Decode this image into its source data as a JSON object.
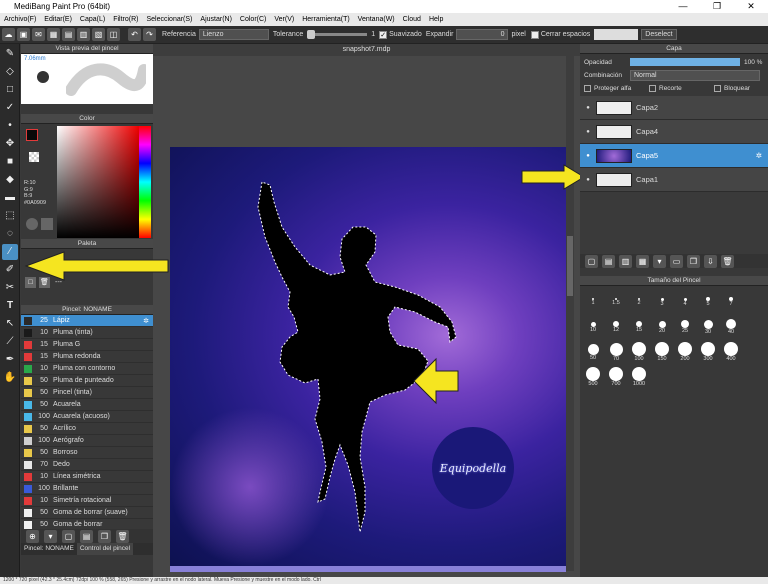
{
  "window": {
    "title": "MediBang Paint Pro (64bit)",
    "min": "—",
    "max": "❐",
    "close": "✕"
  },
  "menu": [
    "Archivo(F)",
    "Editar(E)",
    "Capa(L)",
    "Filtro(R)",
    "Seleccionar(S)",
    "Ajustar(N)",
    "Color(C)",
    "Ver(V)",
    "Herramienta(T)",
    "Ventana(W)",
    "Cloud",
    "Help"
  ],
  "toolbar": {
    "referencia_label": "Referencia",
    "referencia_value": "Lienzo",
    "tolerance_label": "Tolerance",
    "tolerance_value": "1",
    "suavizado_label": "Suavizado",
    "expandir_label": "Expandir",
    "expandir_value": "0",
    "expandir_unit": "pixel",
    "cerrar_label": "Cerrar espacios",
    "deselect_label": "Deselect"
  },
  "preview_panel": {
    "title": "Vista previa del pincel",
    "size": "7.06mm"
  },
  "color_panel": {
    "title": "Color",
    "r": "R:10",
    "g": "G:9",
    "b": "B:9",
    "hex": "#0A0909"
  },
  "palette_panel": {
    "title": "Paleta",
    "empty": "---"
  },
  "brush_panel": {
    "title": "Pincel: NONAME",
    "brushes": [
      {
        "size": "25",
        "name": "Lápiz",
        "color": "#2a2a2a",
        "selected": true
      },
      {
        "size": "10",
        "name": "Pluma (tinta)",
        "color": "#1a1a1a"
      },
      {
        "size": "15",
        "name": "Pluma G",
        "color": "#e23a3a"
      },
      {
        "size": "15",
        "name": "Pluma redonda",
        "color": "#e23a3a"
      },
      {
        "size": "10",
        "name": "Pluma con contorno",
        "color": "#2aa84a"
      },
      {
        "size": "50",
        "name": "Pluma de punteado",
        "color": "#e8c84a"
      },
      {
        "size": "50",
        "name": "Pincel (tinta)",
        "color": "#e8c84a"
      },
      {
        "size": "50",
        "name": "Acuarela",
        "color": "#49b8e8"
      },
      {
        "size": "100",
        "name": "Acuarela (acuoso)",
        "color": "#49b8e8"
      },
      {
        "size": "50",
        "name": "Acrílico",
        "color": "#e8c84a"
      },
      {
        "size": "100",
        "name": "Aerógrafo",
        "color": "#cfcfcf"
      },
      {
        "size": "50",
        "name": "Borroso",
        "color": "#e8c84a"
      },
      {
        "size": "70",
        "name": "Dedo",
        "color": "#e8e8e8"
      },
      {
        "size": "10",
        "name": "Línea simétrica",
        "color": "#e23a3a"
      },
      {
        "size": "100",
        "name": "Brillante",
        "color": "#3a5ad8"
      },
      {
        "size": "10",
        "name": "Simetría rotacional",
        "color": "#e23a3a"
      },
      {
        "size": "50",
        "name": "Goma de borrar (suave)",
        "color": "#f0f0f0"
      },
      {
        "size": "50",
        "name": "Goma de borrar",
        "color": "#f0f0f0"
      }
    ],
    "tab1": "Pincel: NONAME",
    "tab2": "Control del pincel"
  },
  "canvas": {
    "doc_tab": "snapshot7.mdp",
    "watermark": "Equipodella",
    "accent": "#f5e520"
  },
  "layer_panel": {
    "title": "Capa",
    "opacity_label": "Opacidad",
    "opacity_value": "100 %",
    "blend_label": "Combinación",
    "blend_value": "Normal",
    "protect_label": "Proteger alfa",
    "clip_label": "Recorte",
    "lock_label": "Bloquear",
    "layers": [
      {
        "name": "Capa2",
        "selected": false
      },
      {
        "name": "Capa4",
        "selected": false
      },
      {
        "name": "Capa5",
        "selected": true
      },
      {
        "name": "Capa1",
        "selected": false
      }
    ]
  },
  "brush_size_panel": {
    "title": "Tamaño del Pincel",
    "sizes": [
      "1",
      "1.5",
      "2",
      "3",
      "4",
      "5",
      "7",
      "10",
      "12",
      "15",
      "20",
      "25",
      "30",
      "40",
      "50",
      "70",
      "100",
      "150",
      "200",
      "300",
      "400",
      "500",
      "700",
      "1000"
    ]
  },
  "status": {
    "text": "1200 * 720 pixel (42.3 * 25.4cm) 72dpi 100 %  (558, 265)  Presione y arrastre en el nodo lateral. Mueva Presione y muestre en el modo lado. Ctrl"
  }
}
